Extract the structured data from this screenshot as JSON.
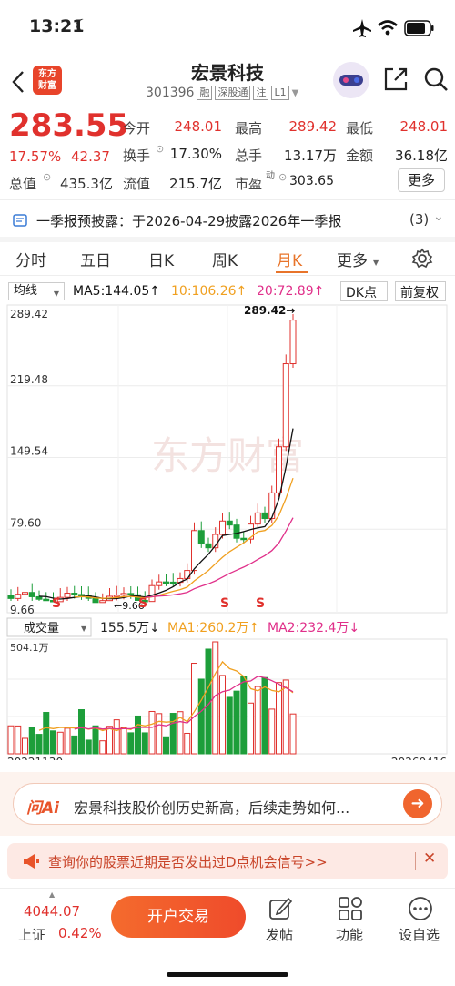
{
  "status": {
    "time": "13:21"
  },
  "header": {
    "logo_line1": "东方",
    "logo_line2": "财富",
    "stock_name": "宏景科技",
    "stock_code": "301396",
    "tags": [
      "融",
      "深股通",
      "注",
      "L1"
    ]
  },
  "quote": {
    "price": "283.55",
    "change_pct": "17.57%",
    "change_amt": "42.37",
    "open_label": "今开",
    "open": "248.01",
    "high_label": "最高",
    "high": "289.42",
    "low_label": "最低",
    "low": "248.01",
    "turnover_label": "换手",
    "turnover": "17.30%",
    "volume_label": "总手",
    "volume": "13.17万",
    "amount_label": "金额",
    "amount": "36.18亿",
    "mktcap_label": "总值",
    "mktcap": "435.3亿",
    "float_label": "流值",
    "float": "215.7亿",
    "pe_label": "市盈",
    "pe_superscript": "动",
    "pe": "303.65",
    "more_label": "更多"
  },
  "notice": {
    "text": "一季报预披露：于2026-04-29披露2026年一季报",
    "count": "(3)"
  },
  "tabs": [
    "分时",
    "五日",
    "日K",
    "周K",
    "月K",
    "更多"
  ],
  "active_tab": "月K",
  "chart_toolbar": {
    "indicator": "均线",
    "ma5": "MA5:144.05↑",
    "ma10": "10:106.26↑",
    "ma20": "20:72.89↑",
    "dk": "DK点",
    "adjust": "前复权"
  },
  "volume_toolbar": {
    "indicator": "成交量",
    "vol": "155.5万↓",
    "ma1": "MA1:260.2万↑",
    "ma2": "MA2:232.4万↓"
  },
  "colors": {
    "up": "#e0312d",
    "down": "#1d9e3a",
    "ma5": "#111111",
    "ma10": "#f0a020",
    "ma20": "#e0308a",
    "accent": "#e8742a"
  },
  "chart_data": {
    "type": "candlestick",
    "y_ticks": [
      "289.42",
      "219.48",
      "149.54",
      "79.60",
      "9.66"
    ],
    "ylim": [
      9.66,
      289.42
    ],
    "high_label": "289.42→",
    "low_label": "←9.66",
    "start_date": "20221130",
    "end_date": "20260416",
    "volume_max_label": "504.1万",
    "signals": [
      "S",
      "S",
      "S",
      "S"
    ],
    "watermark": "东方财富"
  },
  "ai_bar": {
    "brand": "问Ai",
    "text": "宏景科技股价创历史新高，后续走势如何..."
  },
  "promo": {
    "text": "查询你的股票近期是否发出过D点机会信号>>"
  },
  "bottom": {
    "index_value": "4044.07",
    "index_name": "上证",
    "index_change": "0.42%",
    "trade_button": "开户交易",
    "post_label": "发帖",
    "func_label": "功能",
    "custom_label": "设自选"
  }
}
